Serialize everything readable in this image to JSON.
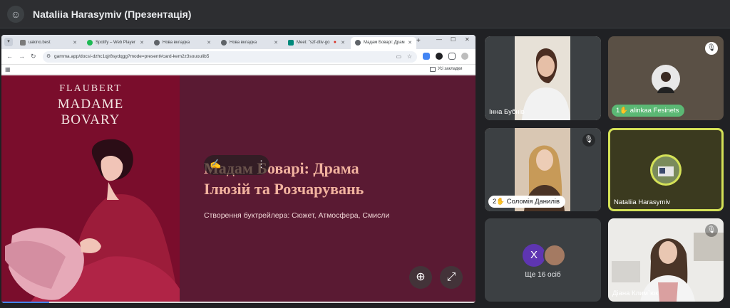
{
  "meeting": {
    "title": "Nataliia Harasymiv (Презентація)"
  },
  "browser": {
    "tabs": [
      {
        "label": "uakino.best",
        "color": "#7a7a7a"
      },
      {
        "label": "Spotify – Web Player",
        "color": "#1db954"
      },
      {
        "label": "Нова вкладка",
        "color": "#5f6368"
      },
      {
        "label": "Нова вкладка",
        "color": "#5f6368"
      },
      {
        "label": "Meet: \"szf-dtiv-go",
        "color": "#00897b"
      },
      {
        "label": "Мадам Боварі: Драм",
        "color": "#5f6368"
      }
    ],
    "url": "gamma.app/docs/-dzhc1qjr8sydqgg?mode=present#card-kem2z3sououlib5",
    "bookmarks_label": "Усі закладки"
  },
  "slide": {
    "cover_author": "FLAUBERT",
    "cover_title_1": "MADAME",
    "cover_title_2": "BOVARY",
    "title_line1": "Мадам Боварі: Драма",
    "title_line2": "Ілюзій та Розчарувань",
    "subtitle": "Створення буктрейлера: Сюжет, Атмосфера, Смисли",
    "progress": 0.1
  },
  "participants": [
    {
      "name": "Інна Бубнів",
      "muted": false
    },
    {
      "name": "alinkaa Fesinets",
      "muted": true,
      "badge": "1"
    },
    {
      "name": "Соломія Данилів",
      "muted": true,
      "badge": "2"
    },
    {
      "name": "Nataliia Harasymiv",
      "muted": false,
      "presenter": true
    },
    {
      "more_initial": "X",
      "more_label": "Ще 16 осіб"
    },
    {
      "name": "Діана Клим`юк",
      "muted": true
    }
  ],
  "colors": {
    "meet_bg": "#202124",
    "slide_bg": "#5a1a33",
    "cover_bg": "#7a0d2c",
    "title_accent": "#f2b39f",
    "presenter_border": "#d4e157"
  }
}
